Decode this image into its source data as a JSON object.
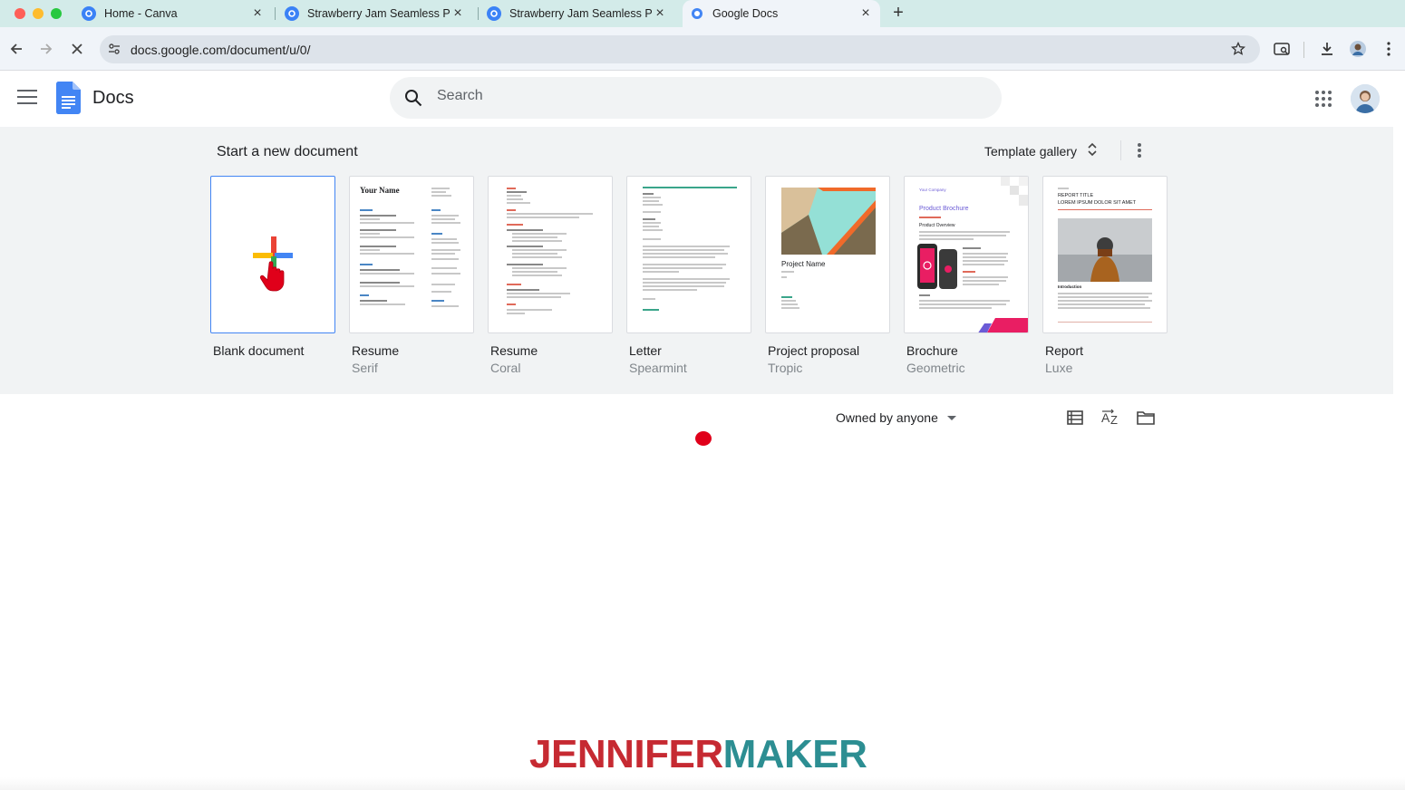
{
  "browser": {
    "tabs": [
      {
        "title": "Home - Canva",
        "icon": "canva-icon",
        "active": false
      },
      {
        "title": "Strawberry Jam Seamless Pat",
        "icon": "canva-icon",
        "active": false
      },
      {
        "title": "Strawberry Jam Seamless Pat",
        "icon": "canva-icon",
        "active": false
      },
      {
        "title": "Google Docs",
        "icon": "google-docs-favicon",
        "active": true
      }
    ],
    "url": "docs.google.com/document/u/0/"
  },
  "header": {
    "app_name": "Docs",
    "search_placeholder": "Search"
  },
  "templates": {
    "section_title": "Start a new document",
    "gallery_label": "Template gallery",
    "items": [
      {
        "name": "Blank document",
        "subtitle": ""
      },
      {
        "name": "Resume",
        "subtitle": "Serif"
      },
      {
        "name": "Resume",
        "subtitle": "Coral"
      },
      {
        "name": "Letter",
        "subtitle": "Spearmint"
      },
      {
        "name": "Project proposal",
        "subtitle": "Tropic"
      },
      {
        "name": "Brochure",
        "subtitle": "Geometric"
      },
      {
        "name": "Report",
        "subtitle": "Luxe"
      }
    ],
    "thumb_text": {
      "resume_serif_name": "Your Name",
      "proposal_name": "Project Name",
      "brochure_company": "Your Company",
      "brochure_title": "Product Brochure",
      "brochure_overview": "Product Overview",
      "report_title": "REPORT TITLE",
      "report_subtitle": "LOREM IPSUM DOLOR SIT AMET",
      "report_intro": "Introduction"
    }
  },
  "list_controls": {
    "owner_filter": "Owned by anyone"
  },
  "watermark": {
    "part1": "JENNIFER",
    "part2": "MAKER"
  },
  "colors": {
    "docs_blue": "#4285f4",
    "tab_bar": "#d3ebe9",
    "watermark_red": "#c62a32",
    "watermark_teal": "#2c8e92"
  }
}
